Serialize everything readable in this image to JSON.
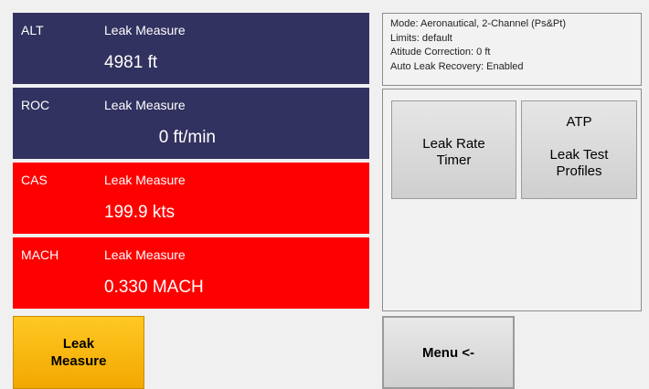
{
  "panels": {
    "alt": {
      "param": "ALT",
      "mode": "Leak Measure",
      "value": "4981",
      "unit": "ft"
    },
    "roc": {
      "param": "ROC",
      "mode": "Leak Measure",
      "value": "0",
      "unit": "ft/min"
    },
    "cas": {
      "param": "CAS",
      "mode": "Leak Measure",
      "value": "199.9",
      "unit": "kts"
    },
    "mach": {
      "param": "MACH",
      "mode": "Leak Measure",
      "value": "0.330",
      "unit": "MACH"
    }
  },
  "leak_button": {
    "line1": "Leak",
    "line2": "Measure"
  },
  "info": {
    "mode": "Mode: Aeronautical, 2-Channel (Ps&Pt)",
    "limits": "Limits: default",
    "altitude_correction": "Atitude Correction: 0 ft",
    "auto_leak_recovery": "Auto Leak Recovery: Enabled"
  },
  "functions": {
    "leak_rate_timer": {
      "line1": "Leak Rate",
      "line2": "Timer"
    },
    "atp": {
      "title": "ATP",
      "line1": "Leak Test",
      "line2": "Profiles"
    }
  },
  "menu_button": {
    "label": "Menu <-"
  },
  "colors": {
    "navy_panel": "#323260",
    "red_panel": "#ff0000",
    "leak_button": "#ffc823"
  }
}
